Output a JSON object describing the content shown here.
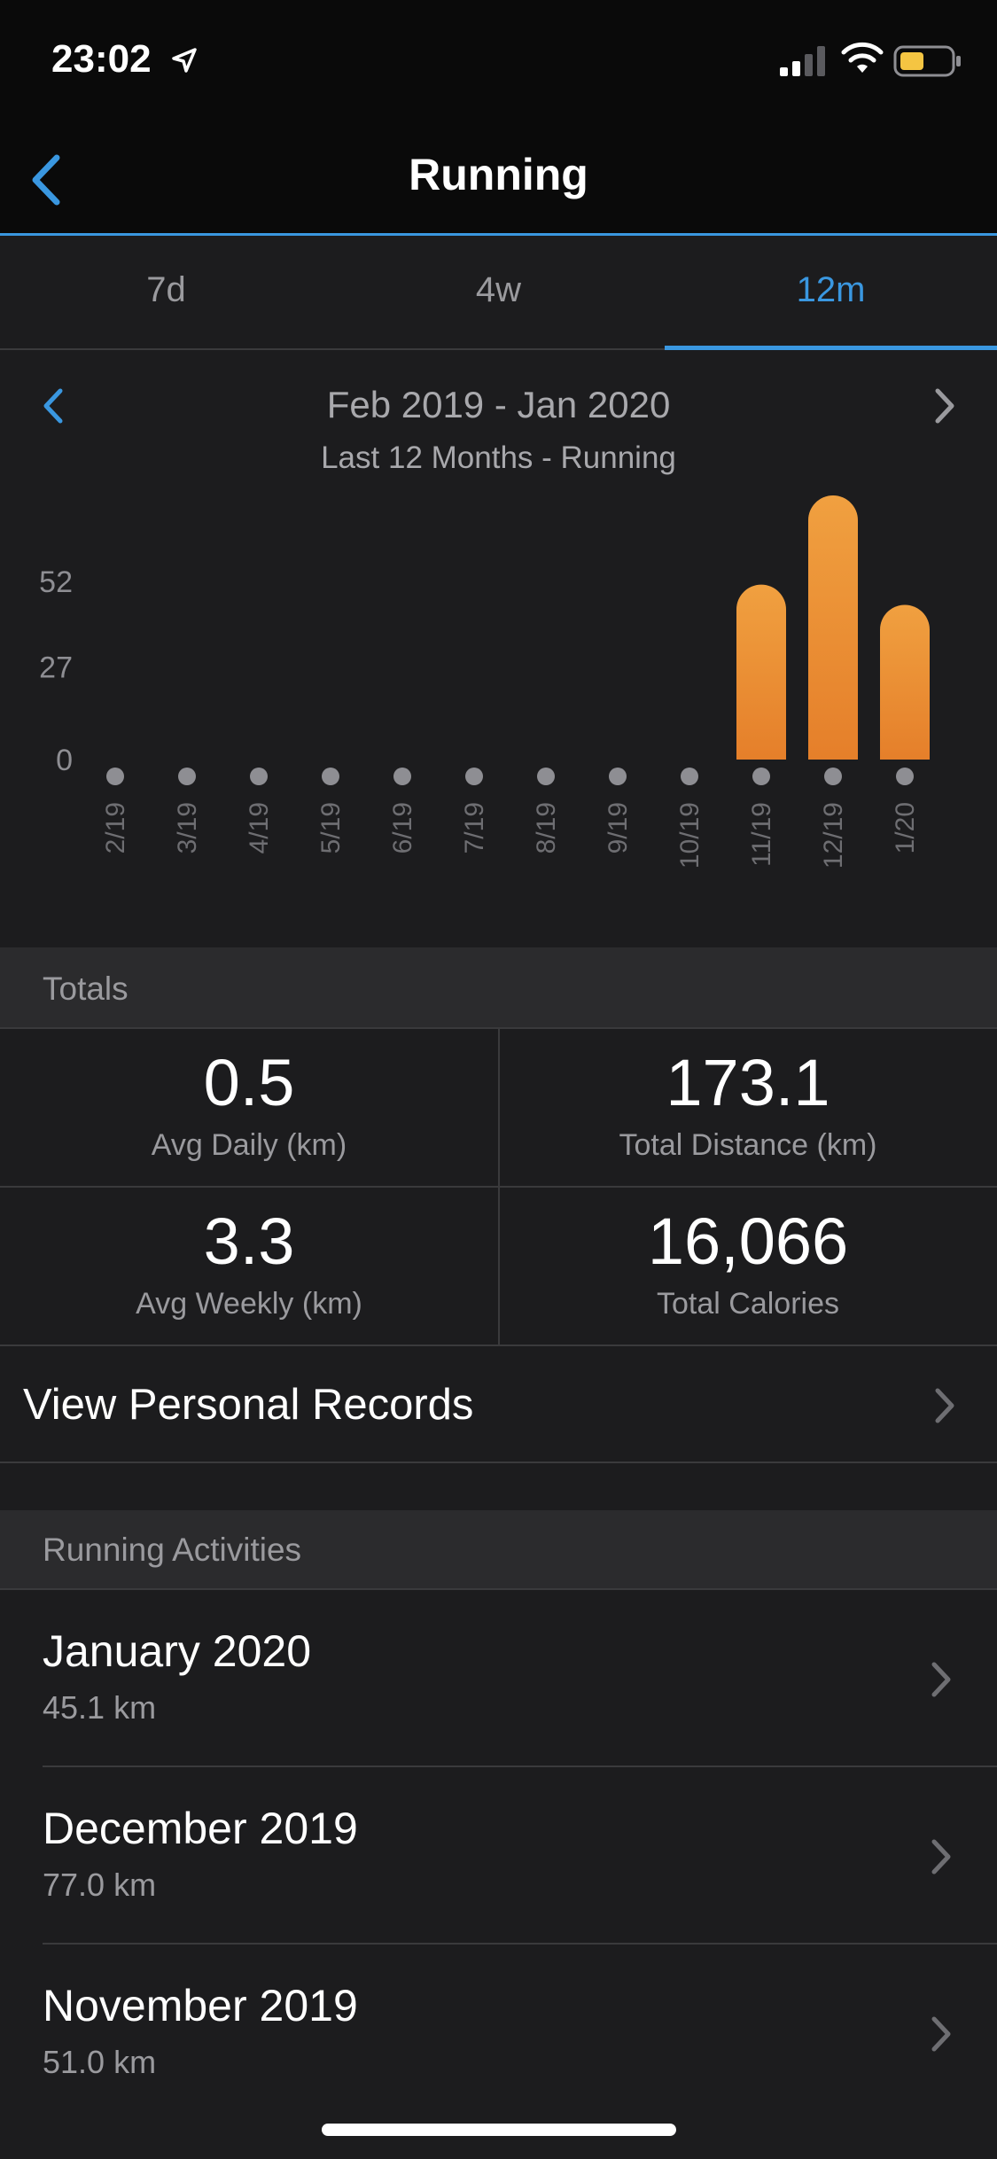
{
  "status_bar": {
    "time": "23:02"
  },
  "nav": {
    "title": "Running"
  },
  "tabs": [
    {
      "label": "7d",
      "active": false
    },
    {
      "label": "4w",
      "active": false
    },
    {
      "label": "12m",
      "active": true
    }
  ],
  "period": {
    "title": "Feb 2019 - Jan 2020",
    "subtitle": "Last 12 Months - Running"
  },
  "chart_data": {
    "type": "bar",
    "categories": [
      "2/19",
      "3/19",
      "4/19",
      "5/19",
      "6/19",
      "7/19",
      "8/19",
      "9/19",
      "10/19",
      "11/19",
      "12/19",
      "1/20"
    ],
    "values": [
      0,
      0,
      0,
      0,
      0,
      0,
      0,
      0,
      0,
      51.0,
      77.0,
      45.1
    ],
    "y_ticks": [
      "0",
      "27",
      "52"
    ],
    "ylim": [
      0,
      77
    ],
    "bar_color": "#f0a040",
    "bar_color_bottom": "#e57f2a",
    "zero_marker_color": "#8e8e93"
  },
  "totals": {
    "header": "Totals",
    "avg_daily": {
      "value": "0.5",
      "label": "Avg Daily (km)"
    },
    "total_distance": {
      "value": "173.1",
      "label": "Total Distance (km)"
    },
    "avg_weekly": {
      "value": "3.3",
      "label": "Avg Weekly (km)"
    },
    "total_calories": {
      "value": "16,066",
      "label": "Total Calories"
    }
  },
  "personal_records": {
    "label": "View Personal Records"
  },
  "activities": {
    "header": "Running Activities",
    "items": [
      {
        "title": "January 2020",
        "distance": "45.1 km"
      },
      {
        "title": "December 2019",
        "distance": "77.0 km"
      },
      {
        "title": "November 2019",
        "distance": "51.0 km"
      }
    ]
  },
  "colors": {
    "accent": "#3a97e0",
    "background": "#1c1c1e",
    "section_header": "#2b2b2d",
    "battery": "#f5c542"
  }
}
